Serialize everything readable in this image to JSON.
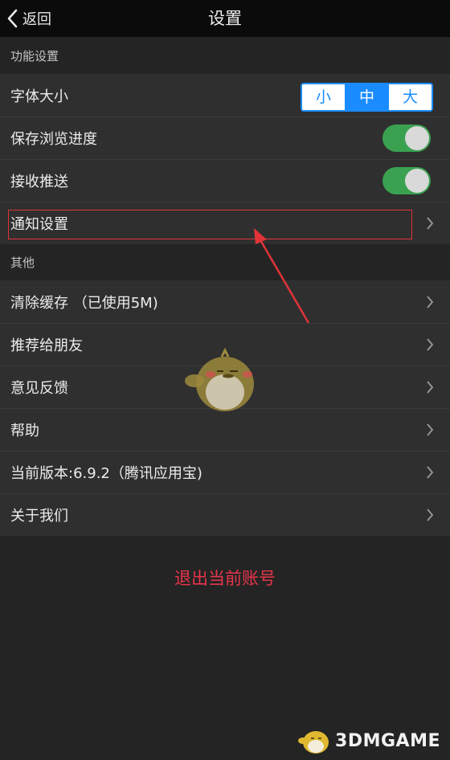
{
  "nav": {
    "back_label": "返回",
    "title": "设置"
  },
  "sections": {
    "functions_header": "功能设置",
    "others_header": "其他"
  },
  "function_rows": {
    "font_size": {
      "label": "字体大小",
      "options": [
        "小",
        "中",
        "大"
      ],
      "selected": "中"
    },
    "save_progress": {
      "label": "保存浏览进度",
      "on": true
    },
    "receive_push": {
      "label": "接收推送",
      "on": true
    },
    "notification": {
      "label": "通知设置"
    }
  },
  "other_rows": {
    "clear_cache": "清除缓存 （已使用5M)",
    "recommend": "推荐给朋友",
    "feedback": "意见反馈",
    "help": "帮助",
    "version": "当前版本:6.9.2（腾讯应用宝)",
    "about": "关于我们"
  },
  "logout_label": "退出当前账号",
  "watermark": "3DMGAME",
  "colors": {
    "accent_blue": "#1a8cff",
    "toggle_on": "#3aa151",
    "logout_red": "#e7354a",
    "annotation_red": "#e0343a"
  },
  "icons": [
    "back-chevron-icon",
    "chevron-right-icon",
    "mascot-bird-icon",
    "annotation-arrow-icon"
  ]
}
